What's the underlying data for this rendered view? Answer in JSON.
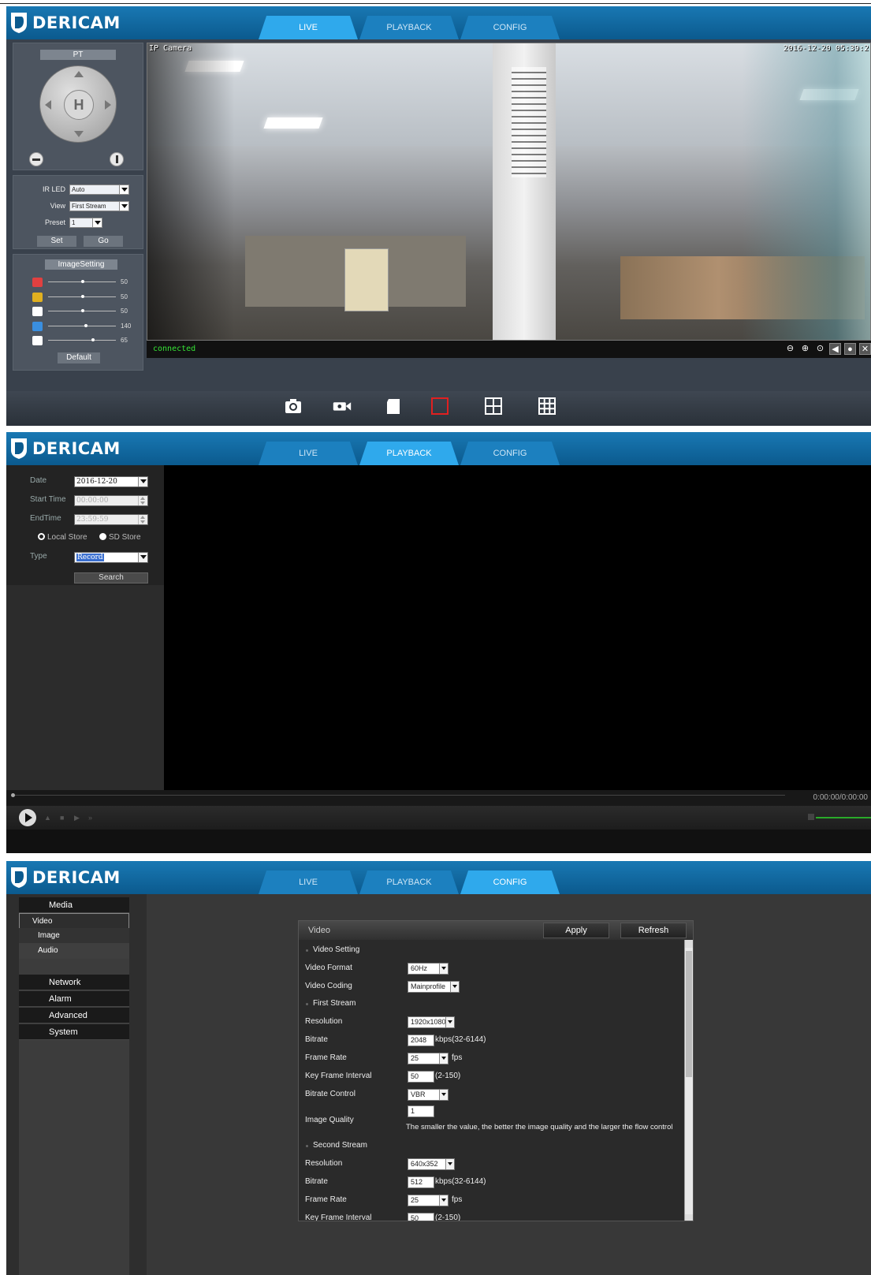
{
  "brand": "DERICAM",
  "tabs": [
    "LIVE",
    "PLAYBACK",
    "CONFIG"
  ],
  "colors": {
    "header": "#0b5a8e",
    "tab_active": "#2fa9ec",
    "status_ok": "#35e335"
  },
  "live": {
    "pt_title": "PT",
    "dpad_center": "H",
    "ir_led_label": "IR LED",
    "ir_led_value": "Auto",
    "view_label": "View",
    "view_value": "First Stream",
    "preset_label": "Preset",
    "preset_value": "1",
    "set_btn": "Set",
    "go_btn": "Go",
    "image_setting_title": "ImageSetting",
    "sliders": [
      {
        "icon": "hue-icon",
        "value": 50,
        "max": 100,
        "color": "#e04040"
      },
      {
        "icon": "brightness-icon",
        "value": 50,
        "max": 100,
        "color": "#e0b020"
      },
      {
        "icon": "contrast-icon",
        "value": 50,
        "max": 100,
        "color": "#ffffff"
      },
      {
        "icon": "saturation-icon",
        "value": 140,
        "max": 255,
        "color": "#3a8fe0"
      },
      {
        "icon": "sharpness-icon",
        "value": 65,
        "max": 100,
        "color": "#ffffff"
      }
    ],
    "default_btn": "Default",
    "osd_name": "IP Camera",
    "osd_time": "2016-12-20 05:39:2",
    "status": "connected"
  },
  "playback": {
    "date_label": "Date",
    "date_value": "2016-12-20",
    "start_label": "Start Time",
    "start_value": "00:00:00",
    "end_label": "EndTime",
    "end_value": "23:59:59",
    "local_store": "Local Store",
    "sd_store": "SD Store",
    "type_label": "Type",
    "type_value": "Record",
    "search_btn": "Search",
    "time_display": "0:00:00/0:00:00"
  },
  "config": {
    "menu": [
      {
        "label": "Media",
        "kind": "top"
      },
      {
        "label": "Video",
        "kind": "sub-selected"
      },
      {
        "label": "Image",
        "kind": "sub"
      },
      {
        "label": "Audio",
        "kind": "sub"
      },
      {
        "label": "Network",
        "kind": "top"
      },
      {
        "label": "Alarm",
        "kind": "top"
      },
      {
        "label": "Advanced",
        "kind": "top"
      },
      {
        "label": "System",
        "kind": "top"
      }
    ],
    "panel_title": "Video",
    "apply_btn": "Apply",
    "refresh_btn": "Refresh",
    "video_setting": "Video Setting",
    "video_format_label": "Video Format",
    "video_format_value": "60Hz",
    "video_coding_label": "Video Coding",
    "video_coding_value": "Mainprofile",
    "first_stream": "First Stream",
    "resolution_label": "Resolution",
    "first_resolution": "1920x1080",
    "bitrate_label": "Bitrate",
    "first_bitrate": "2048",
    "bitrate_range": "kbps(32-6144)",
    "frame_rate_label": "Frame Rate",
    "first_frame_rate": "25",
    "fps": "fps",
    "key_frame_label": "Key Frame Interval",
    "first_key_frame": "50",
    "key_frame_range": "(2-150)",
    "bitrate_control_label": "Bitrate Control",
    "bitrate_control_value": "VBR",
    "image_quality_label": "Image Quality",
    "image_quality_value": "1",
    "image_quality_hint": "The smaller the value, the better the image quality and the larger the flow control",
    "second_stream": "Second Stream",
    "second_resolution": "640x352",
    "second_bitrate": "512",
    "second_frame_rate": "25",
    "second_key_frame": "50"
  }
}
